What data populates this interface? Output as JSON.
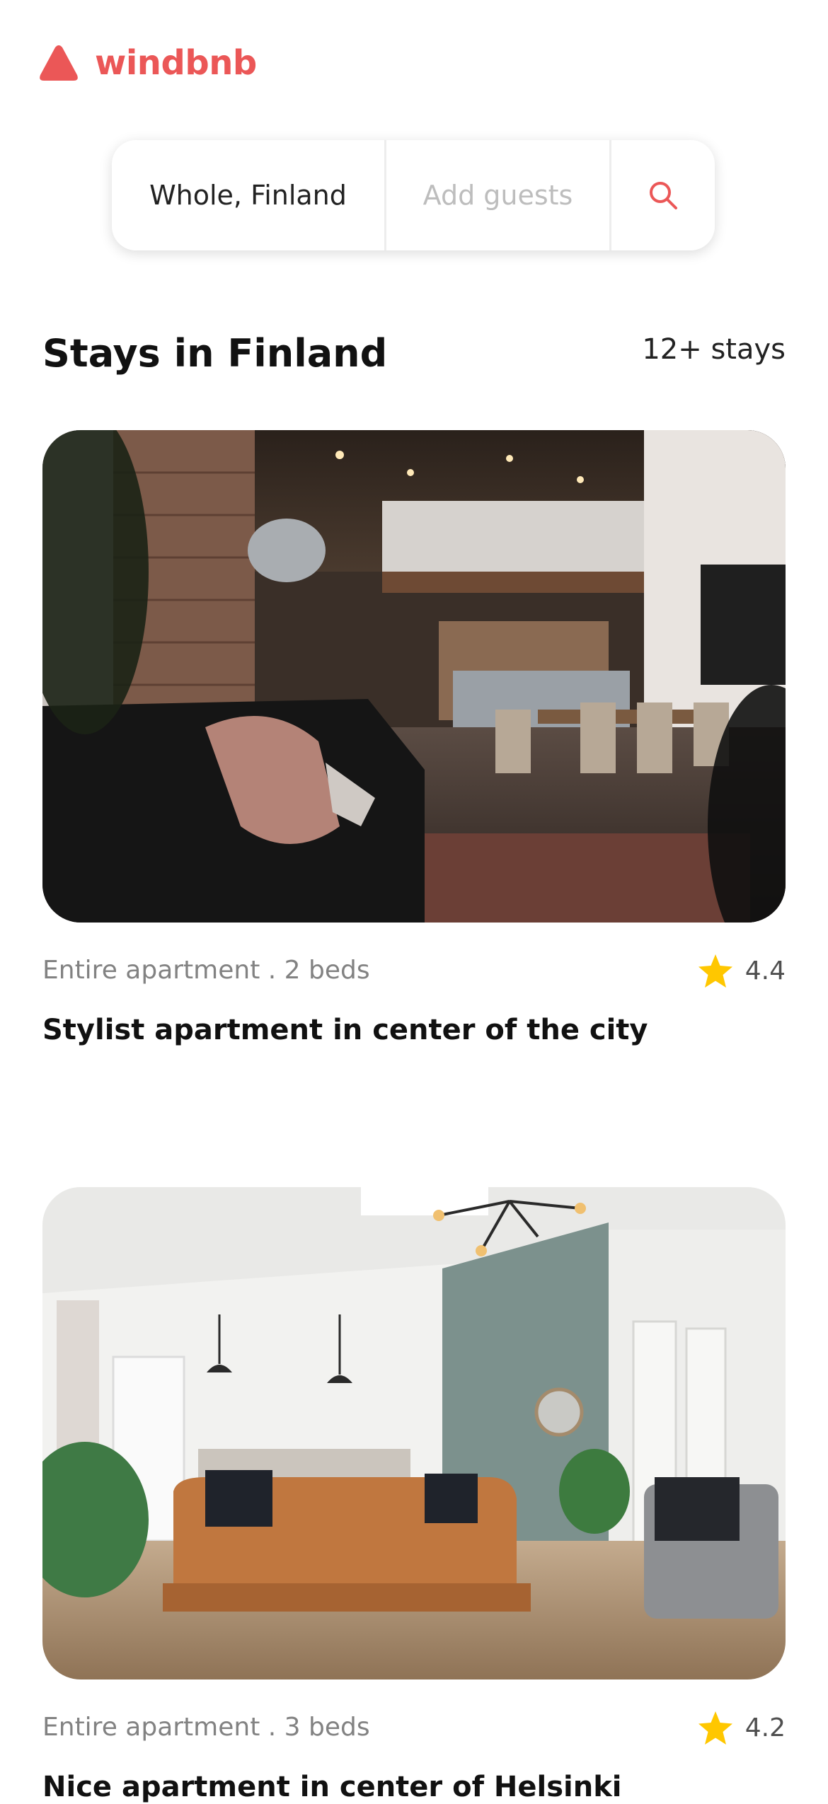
{
  "brand": {
    "name": "windbnb",
    "logo_icon": "triangle-logo-icon",
    "accent_color": "#EB5757"
  },
  "search": {
    "location": "Whole, Finland",
    "guests_placeholder": "Add guests",
    "button_icon": "search-icon"
  },
  "section": {
    "title": "Stays in Finland",
    "count": "12+ stays"
  },
  "stays": [
    {
      "type": "Entire apartment . 2 beds",
      "rating": "4.4",
      "title": "Stylist apartment in center of the city",
      "photo_icon": "loft-apartment-photo"
    },
    {
      "type": "Entire apartment . 3 beds",
      "rating": "4.2",
      "title": "Nice apartment in center of Helsinki",
      "photo_icon": "living-room-photo"
    }
  ],
  "star_color": "#FFC700"
}
